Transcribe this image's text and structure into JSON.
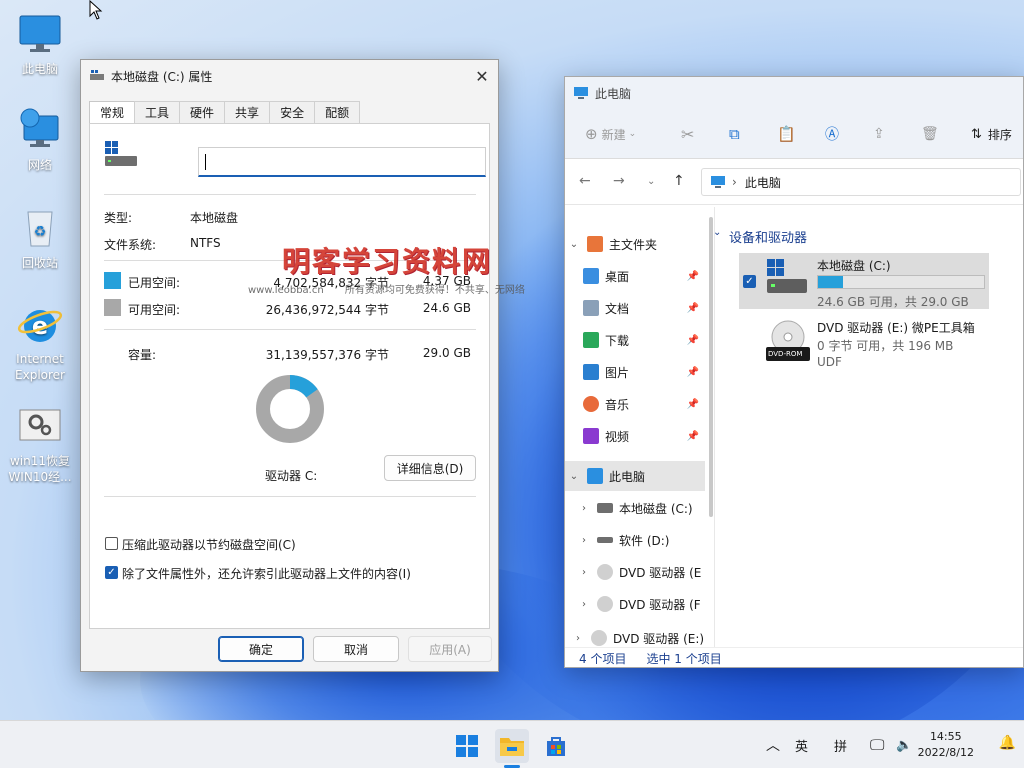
{
  "desktop": {
    "icons": [
      {
        "label": "此电脑"
      },
      {
        "label": "网络"
      },
      {
        "label": "回收站"
      },
      {
        "label": "Internet Explorer"
      },
      {
        "label": "win11恢复WIN10经..."
      }
    ]
  },
  "dialog": {
    "title": "本地磁盘 (C:) 属性",
    "tabs": [
      "常规",
      "工具",
      "硬件",
      "共享",
      "安全",
      "配额"
    ],
    "name_value": "",
    "type_label": "类型:",
    "type_value": "本地磁盘",
    "fs_label": "文件系统:",
    "fs_value": "NTFS",
    "used_label": "已用空间:",
    "used_bytes": "4,702,584,832 字节",
    "used_gb": "4.37 GB",
    "free_label": "可用空间:",
    "free_bytes": "26,436,972,544 字节",
    "free_gb": "24.6 GB",
    "cap_label": "容量:",
    "cap_bytes": "31,139,557,376 字节",
    "cap_gb": "29.0 GB",
    "used_fraction": 0.151,
    "drive_label": "驱动器 C:",
    "details_button": "详细信息(D)",
    "compress_label": "压缩此驱动器以节约磁盘空间(C)",
    "index_label": "除了文件属性外，还允许索引此驱动器上文件的内容(I)",
    "ok": "确定",
    "cancel": "取消",
    "apply": "应用(A)"
  },
  "watermark": {
    "title": "明客学习资料网",
    "url": "www.leobba.cn",
    "note": "所有资源均可免费获得！不共享、无网络"
  },
  "explorer": {
    "title": "此电脑",
    "new_btn": "新建",
    "sort_btn": "排序",
    "address": "此电脑",
    "nav": {
      "quick": "主文件夹",
      "desktop": "桌面",
      "docs": "文档",
      "downloads": "下载",
      "pictures": "图片",
      "music": "音乐",
      "videos": "视频",
      "thispc": "此电脑",
      "c": "本地磁盘 (C:)",
      "d": "软件 (D:)",
      "e": "DVD 驱动器 (E",
      "f": "DVD 驱动器 (F",
      "e2": "DVD 驱动器 (E:)"
    },
    "group_header": "设备和驱动器",
    "drive_c": {
      "name": "本地磁盘 (C:)",
      "sub": "24.6 GB 可用，共 29.0 GB",
      "used_fraction": 0.151
    },
    "drive_e": {
      "name": "DVD 驱动器 (E:) 微PE工具箱",
      "sub": "0 字节 可用，共 196 MB",
      "fs": "UDF",
      "badge": "DVD-ROM"
    },
    "status_items": "4 个项目",
    "status_sel": "选中 1 个项目"
  },
  "taskbar": {
    "lang": "英",
    "ime": "拼",
    "time": "14:55",
    "date": "2022/8/12"
  },
  "colors": {
    "accent": "#1a5fb4",
    "used": "#26a0da",
    "free": "#a8a8a8"
  }
}
